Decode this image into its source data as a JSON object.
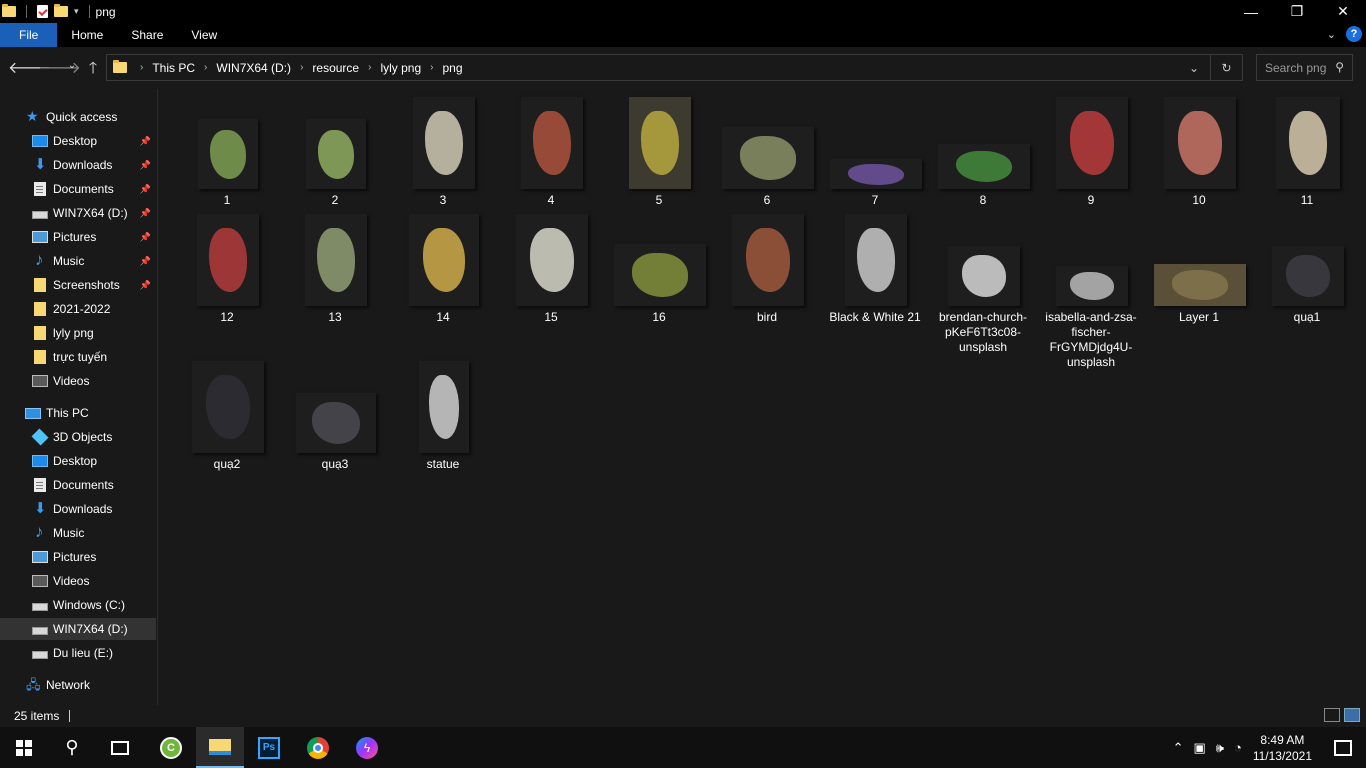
{
  "window": {
    "title": "png",
    "minimize": "—",
    "restore": "❐",
    "close": "✕"
  },
  "ribbon": {
    "tabs": [
      "File",
      "Home",
      "Share",
      "View"
    ]
  },
  "address": {
    "crumbs": [
      "This PC",
      "WIN7X64 (D:)",
      "resource",
      "lyly png",
      "png"
    ],
    "dropdown": "⌄",
    "refresh": "↻"
  },
  "search": {
    "placeholder": "Search png"
  },
  "nav": {
    "quick_access": "Quick access",
    "quick_items": [
      "Desktop",
      "Downloads",
      "Documents",
      "WIN7X64 (D:)",
      "Pictures",
      "Music",
      "Screenshots",
      "2021-2022",
      "lyly png",
      "trực tuyến",
      "Videos"
    ],
    "this_pc": "This PC",
    "pc_items": [
      "3D Objects",
      "Desktop",
      "Documents",
      "Downloads",
      "Music",
      "Pictures",
      "Videos",
      "Windows (C:)",
      "WIN7X64 (D:)",
      "Du lieu (E:)"
    ],
    "network": "Network"
  },
  "files": [
    {
      "name": "1"
    },
    {
      "name": "2"
    },
    {
      "name": "3"
    },
    {
      "name": "4"
    },
    {
      "name": "5"
    },
    {
      "name": "6"
    },
    {
      "name": "7"
    },
    {
      "name": "8"
    },
    {
      "name": "9"
    },
    {
      "name": "10"
    },
    {
      "name": "11"
    },
    {
      "name": "12"
    },
    {
      "name": "13"
    },
    {
      "name": "14"
    },
    {
      "name": "15"
    },
    {
      "name": "16"
    },
    {
      "name": "bird"
    },
    {
      "name": "Black & White 21"
    },
    {
      "name": "brendan-church-pKeF6Tt3c08-unsplash"
    },
    {
      "name": "isabella-and-zsa-fischer-FrGYMDjdg4U-unsplash"
    },
    {
      "name": "Layer 1"
    },
    {
      "name": "quạ1"
    },
    {
      "name": "quạ2"
    },
    {
      "name": "quạ3"
    },
    {
      "name": "statue"
    }
  ],
  "status": {
    "count": "25 items"
  },
  "taskbar": {
    "time": "8:49 AM",
    "date": "11/13/2021",
    "ps_label": "Ps"
  }
}
